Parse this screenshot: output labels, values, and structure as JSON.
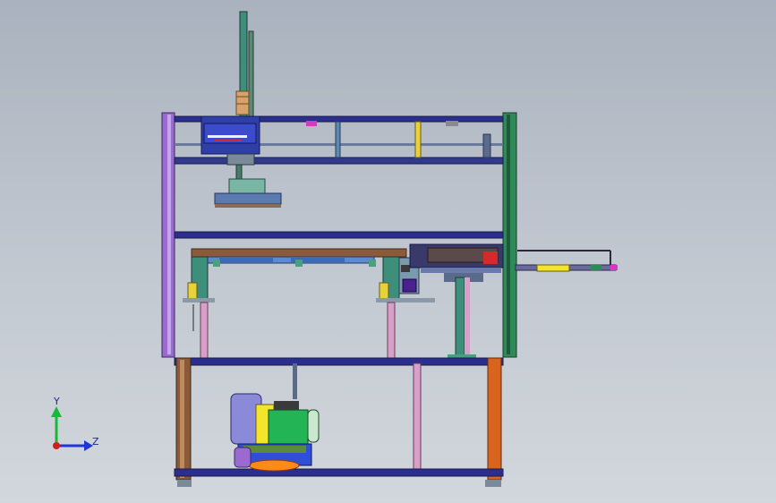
{
  "viewport": {
    "background_top": "#a9b2be",
    "background_bottom": "#d2d7dd"
  },
  "triad": {
    "y_label": "Y",
    "z_label": "Z",
    "y_axis_color": "#19b83a",
    "z_axis_color": "#1f35d6",
    "origin_color": "#d81b1b"
  },
  "palette": {
    "frame_purple": "#9b6ad0",
    "frame_green": "#2f8a5a",
    "frame_blue": "#2a2f8f",
    "frame_brown": "#8a5a3a",
    "frame_orange": "#d8641e",
    "column_teal": "#3d8f7b",
    "gantry_navy": "#2a2f8f",
    "motor_green": "#22b455",
    "motor_blue": "#2f4fd6",
    "motor_orange": "#ff8a1a",
    "motor_purple": "#9b6ad0",
    "accent_yellow": "#f3e52a",
    "accent_red": "#d62a2a",
    "accent_magenta": "#d23ac0",
    "nozzle_purple": "#4a1f8f"
  }
}
